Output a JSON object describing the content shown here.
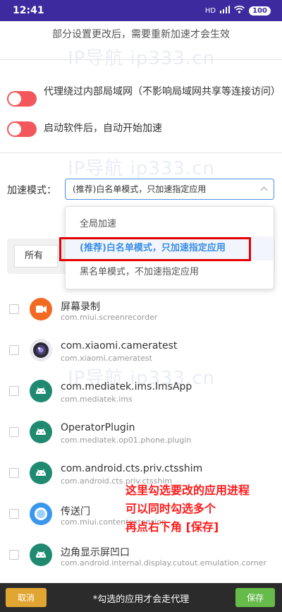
{
  "status_bar": {
    "time": "12:41",
    "battery": "100",
    "network": "HD"
  },
  "notice": "部分设置更改后，需要重新加速才会生效",
  "watermark": "IP导航 ip333.cn",
  "options": [
    {
      "label": "代理绕过内部局域网（不影响局域网共享等连接访问）",
      "enabled": true
    },
    {
      "label": "启动软件后，自动开始加速",
      "enabled": true
    }
  ],
  "mode": {
    "label": "加速模式：",
    "selected": "(推荐)白名单模式，只加速指定应用",
    "options": [
      "全局加速",
      "(推荐)白名单模式，只加速指定应用",
      "黑名单模式，不加速指定应用"
    ]
  },
  "filter": {
    "value": "所有"
  },
  "apps": [
    {
      "name": "屏幕录制",
      "package": "com.miui.screenrecorder",
      "icon": "screen-recorder-icon"
    },
    {
      "name": "com.xiaomi.cameratest",
      "package": "com.xiaomi.cameratest",
      "icon": "camera-icon"
    },
    {
      "name": "com.mediatek.ims.ImsApp",
      "package": "com.mediatek.ims",
      "icon": "android-icon"
    },
    {
      "name": "OperatorPlugin",
      "package": "com.mediatek.op01.phone.plugin",
      "icon": "android-icon"
    },
    {
      "name": "com.android.cts.priv.ctsshim",
      "package": "com.android.cts.priv.ctsshim",
      "icon": "android-icon"
    },
    {
      "name": "传送门",
      "package": "com.miui.contentextension",
      "icon": "portal-icon"
    },
    {
      "name": "边角显示屏凹口",
      "package": "com.android.internal.display.cutout.emulation.corner",
      "icon": "android-icon"
    }
  ],
  "annotation": [
    "这里勾选要改的应用进程",
    "可以同时勾选多个",
    "再点右下角 [保存]"
  ],
  "bottom_bar": {
    "cancel": "取消",
    "hint": "*勾选的应用才会走代理",
    "save": "保存"
  },
  "colors": {
    "status_bar": "#3c2a9e",
    "toggle_on": "#f3575b",
    "accent": "#3a8ee6",
    "cancel": "#e0a631",
    "save": "#66bb4a",
    "annotation": "#ff1a1a"
  }
}
